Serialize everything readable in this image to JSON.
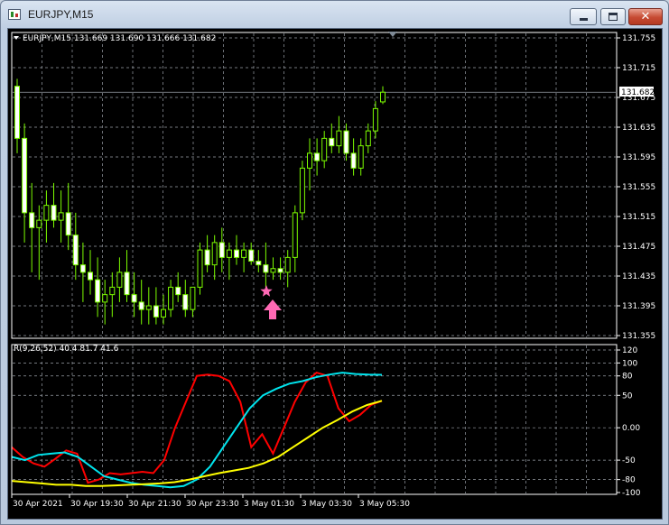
{
  "window": {
    "title": "EURJPY,M15",
    "minimize_icon": "minimize-icon",
    "maximize_icon": "maximize-icon",
    "close_icon": "close-icon"
  },
  "colors": {
    "background": "#000000",
    "grid": "#9aa0a8",
    "foreground": "#ffffff",
    "candle": "#7CFC00",
    "candle_bull_fill": "#000000",
    "candle_bear_fill": "#ffffff",
    "bid_line": "#9aa0a8",
    "signal_marker": "#ff69b4",
    "indicator_red": "#ff0000",
    "indicator_cyan": "#00e5ee",
    "indicator_yellow": "#ffff00"
  },
  "price_panel": {
    "symbol_header": "EURJPY,M15  131.669 131.690 131.666 131.682",
    "current_price_label": "131.682",
    "price_ticks": [
      "131.755",
      "131.715",
      "131.675",
      "131.635",
      "131.595",
      "131.555",
      "131.515",
      "131.475",
      "131.435",
      "131.395",
      "131.355"
    ],
    "markers": [
      "star-icon",
      "up-arrow-icon"
    ]
  },
  "indicator_panel": {
    "header": "R(9,26,52) 40.4 81.7 41.6",
    "value_ticks": [
      "120",
      "100",
      "80",
      "50",
      "0.00",
      "-50",
      "-80",
      "-100"
    ]
  },
  "time_axis": {
    "labels": [
      "30 Apr 2021",
      "30 Apr 19:30",
      "30 Apr 21:30",
      "30 Apr 23:30",
      "3 May 01:30",
      "3 May 03:30",
      "3 May 05:30"
    ]
  },
  "chart_data": [
    {
      "type": "candlestick",
      "title": "EURJPY,M15",
      "ylim": [
        131.355,
        131.755
      ],
      "ohlc": [
        [
          131.69,
          131.7,
          131.6,
          131.62
        ],
        [
          131.62,
          131.64,
          131.48,
          131.52
        ],
        [
          131.52,
          131.56,
          131.44,
          131.5
        ],
        [
          131.5,
          131.53,
          131.43,
          131.51
        ],
        [
          131.51,
          131.55,
          131.48,
          131.53
        ],
        [
          131.53,
          131.56,
          131.5,
          131.51
        ],
        [
          131.51,
          131.55,
          131.48,
          131.52
        ],
        [
          131.52,
          131.56,
          131.47,
          131.49
        ],
        [
          131.49,
          131.52,
          131.43,
          131.45
        ],
        [
          131.45,
          131.48,
          131.4,
          131.44
        ],
        [
          131.44,
          131.47,
          131.41,
          131.43
        ],
        [
          131.43,
          131.46,
          131.38,
          131.4
        ],
        [
          131.4,
          131.43,
          131.37,
          131.41
        ],
        [
          131.41,
          131.44,
          131.38,
          131.42
        ],
        [
          131.42,
          131.46,
          131.4,
          131.44
        ],
        [
          131.44,
          131.47,
          131.4,
          131.41
        ],
        [
          131.41,
          131.44,
          131.38,
          131.4
        ],
        [
          131.4,
          131.43,
          131.37,
          131.39
        ],
        [
          131.39,
          131.42,
          131.37,
          131.395
        ],
        [
          131.395,
          131.42,
          131.37,
          131.38
        ],
        [
          131.38,
          131.41,
          131.37,
          131.39
        ],
        [
          131.39,
          131.43,
          131.38,
          131.42
        ],
        [
          131.42,
          131.44,
          131.4,
          131.41
        ],
        [
          131.41,
          131.43,
          131.38,
          131.39
        ],
        [
          131.39,
          131.42,
          131.38,
          131.42
        ],
        [
          131.42,
          131.48,
          131.41,
          131.47
        ],
        [
          131.47,
          131.49,
          131.44,
          131.45
        ],
        [
          131.45,
          131.49,
          131.43,
          131.48
        ],
        [
          131.48,
          131.5,
          131.44,
          131.46
        ],
        [
          131.46,
          131.48,
          131.43,
          131.47
        ],
        [
          131.47,
          131.49,
          131.45,
          131.46
        ],
        [
          131.46,
          131.48,
          131.44,
          131.47
        ],
        [
          131.47,
          131.48,
          131.45,
          131.455
        ],
        [
          131.455,
          131.47,
          131.44,
          131.45
        ],
        [
          131.45,
          131.48,
          131.42,
          131.44
        ],
        [
          131.44,
          131.46,
          131.43,
          131.445
        ],
        [
          131.445,
          131.46,
          131.43,
          131.44
        ],
        [
          131.44,
          131.47,
          131.42,
          131.46
        ],
        [
          131.46,
          131.53,
          131.44,
          131.52
        ],
        [
          131.52,
          131.59,
          131.51,
          131.58
        ],
        [
          131.58,
          131.62,
          131.55,
          131.6
        ],
        [
          131.6,
          131.62,
          131.57,
          131.59
        ],
        [
          131.59,
          131.63,
          131.58,
          131.62
        ],
        [
          131.62,
          131.64,
          131.6,
          131.61
        ],
        [
          131.61,
          131.65,
          131.6,
          131.63
        ],
        [
          131.63,
          131.64,
          131.59,
          131.6
        ],
        [
          131.6,
          131.62,
          131.57,
          131.58
        ],
        [
          131.58,
          131.62,
          131.57,
          131.61
        ],
        [
          131.61,
          131.64,
          131.6,
          131.63
        ],
        [
          131.63,
          131.67,
          131.62,
          131.66
        ],
        [
          131.669,
          131.69,
          131.666,
          131.682
        ]
      ]
    },
    {
      "type": "line",
      "title": "R(9,26,52)",
      "ylim": [
        -100,
        120
      ],
      "series": [
        {
          "name": "red",
          "values": [
            -30,
            -45,
            -55,
            -60,
            -48,
            -35,
            -40,
            -85,
            -80,
            -70,
            -72,
            -70,
            -68,
            -70,
            -50,
            0,
            40,
            80,
            82,
            80,
            72,
            40,
            -30,
            -10,
            -40,
            0,
            40,
            70,
            85,
            80,
            30,
            10,
            20,
            35,
            41.6
          ]
        },
        {
          "name": "cyan",
          "values": [
            -45,
            -50,
            -42,
            -40,
            -38,
            -45,
            -60,
            -75,
            -80,
            -85,
            -88,
            -90,
            -92,
            -90,
            -80,
            -60,
            -30,
            0,
            30,
            50,
            60,
            68,
            72,
            78,
            82,
            85,
            83,
            82,
            81.7
          ]
        },
        {
          "name": "yellow",
          "values": [
            -82,
            -84,
            -86,
            -88,
            -88,
            -90,
            -90,
            -89,
            -88,
            -87,
            -86,
            -84,
            -80,
            -75,
            -70,
            -66,
            -62,
            -55,
            -45,
            -30,
            -15,
            0,
            12,
            25,
            35,
            41.6
          ]
        }
      ]
    }
  ]
}
